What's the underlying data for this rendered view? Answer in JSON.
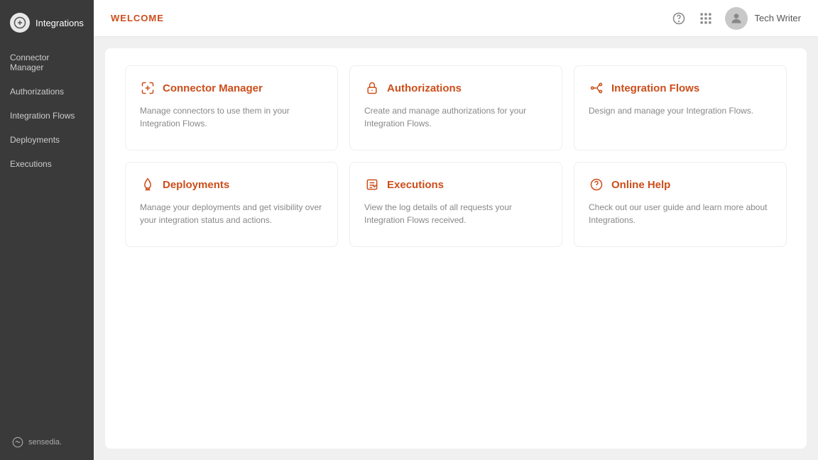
{
  "sidebar": {
    "logo_text": "Integrations",
    "items": [
      {
        "label": "Connector Manager",
        "id": "connector-manager"
      },
      {
        "label": "Authorizations",
        "id": "authorizations"
      },
      {
        "label": "Integration Flows",
        "id": "integration-flows"
      },
      {
        "label": "Deployments",
        "id": "deployments"
      },
      {
        "label": "Executions",
        "id": "executions"
      }
    ],
    "sensedia_label": "sensedia."
  },
  "header": {
    "title": "WELCOME",
    "username": "Tech Writer"
  },
  "cards": [
    {
      "id": "connector-manager",
      "title": "Connector Manager",
      "description": "Manage connectors to use them in your Integration Flows.",
      "icon": "connector"
    },
    {
      "id": "authorizations",
      "title": "Authorizations",
      "description": "Create and manage authorizations for your Integration Flows.",
      "icon": "lock"
    },
    {
      "id": "integration-flows",
      "title": "Integration Flows",
      "description": "Design and manage your Integration Flows.",
      "icon": "flows"
    },
    {
      "id": "deployments",
      "title": "Deployments",
      "description": "Manage your deployments and get visibility over your integration status and actions.",
      "icon": "rocket"
    },
    {
      "id": "executions",
      "title": "Executions",
      "description": "View the log details of all requests your Integration Flows received.",
      "icon": "executions"
    },
    {
      "id": "online-help",
      "title": "Online Help",
      "description": "Check out our user guide and learn more about Integrations.",
      "icon": "help"
    }
  ]
}
